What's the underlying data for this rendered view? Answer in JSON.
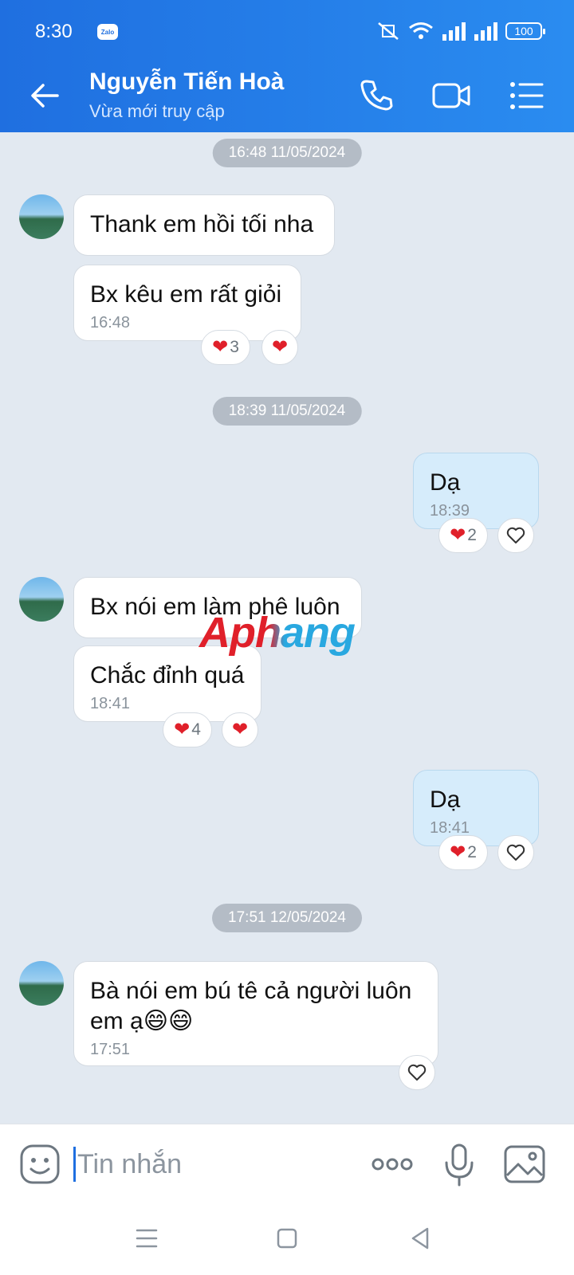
{
  "status": {
    "time": "8:30",
    "zalo_badge": "Zalo",
    "battery": "100"
  },
  "header": {
    "name": "Nguyễn Tiến Hoà",
    "subtitle": "Vừa mới truy cập"
  },
  "chat": {
    "dates": [
      "16:48 11/05/2024",
      "18:39 11/05/2024",
      "17:51 12/05/2024"
    ],
    "messages": [
      {
        "text": "Thank em hồi tối nha"
      },
      {
        "text": "Bx kêu em rất giỏi",
        "time": "16:48",
        "react_count": "3"
      },
      {
        "text": "Dạ",
        "time": "18:39",
        "react_count": "2"
      },
      {
        "text": "Bx nói em làm phê luôn"
      },
      {
        "text": "Chắc đỉnh quá",
        "time": "18:41",
        "react_count": "4"
      },
      {
        "text": "Dạ",
        "time": "18:41",
        "react_count": "2"
      },
      {
        "text": "Bà nói em bú tê cả người luôn em ạ😄😄",
        "time": "17:51"
      }
    ]
  },
  "watermark": {
    "text": "Aphang"
  },
  "composer": {
    "placeholder": "Tin nhắn"
  },
  "icons": {
    "back": "arrow-left-icon",
    "call": "phone-icon",
    "video": "video-icon",
    "menu": "list-menu-icon",
    "emoji": "emoji-icon",
    "more": "more-dots-icon",
    "mic": "microphone-icon",
    "image": "image-icon",
    "heart": "heart-icon",
    "heart_outline": "heart-outline-icon"
  },
  "colors": {
    "header": "#1f6fe0",
    "bubble_in": "#ffffff",
    "bubble_out": "#d6ecfb",
    "heart": "#e0202a",
    "background": "#e2e9f1"
  }
}
